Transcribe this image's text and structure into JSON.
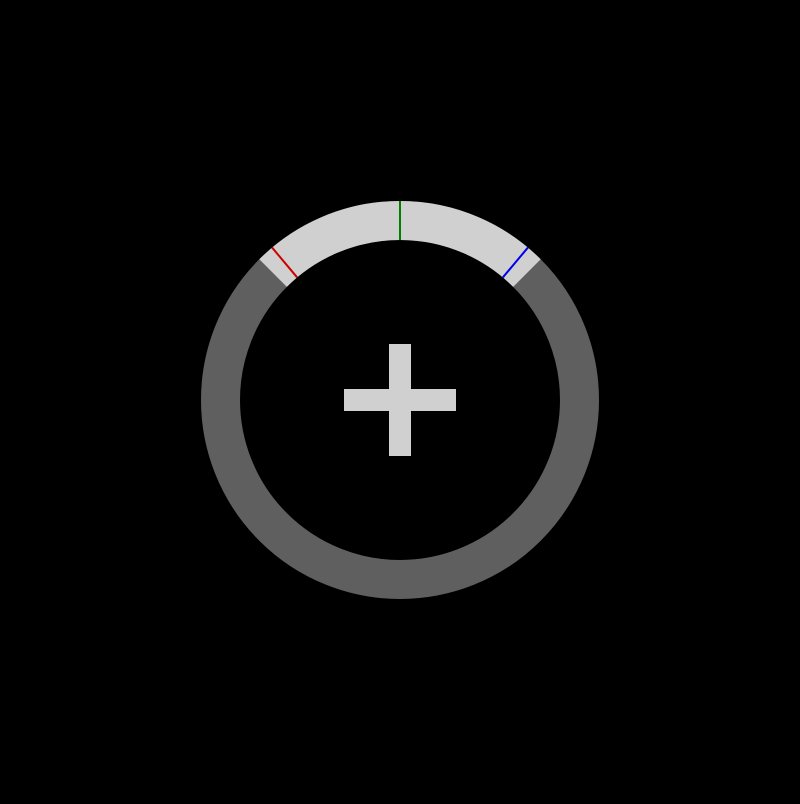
{
  "colors": {
    "background": "#000000",
    "ring_track": "#5f5f5f",
    "highlight": "#d0d0d0",
    "center_icon": "#d0d0d0",
    "marker_left": "#cc0000",
    "marker_center": "#008000",
    "marker_right": "#0000ee"
  },
  "icons": {
    "center": "plus-icon"
  },
  "dial": {
    "highlight_arc_degrees": 90,
    "markers": [
      {
        "name": "marker-left",
        "angle_degrees": -40,
        "color_key": "marker_left"
      },
      {
        "name": "marker-center",
        "angle_degrees": 0,
        "color_key": "marker_center"
      },
      {
        "name": "marker-right",
        "angle_degrees": 40,
        "color_key": "marker_right"
      }
    ]
  }
}
